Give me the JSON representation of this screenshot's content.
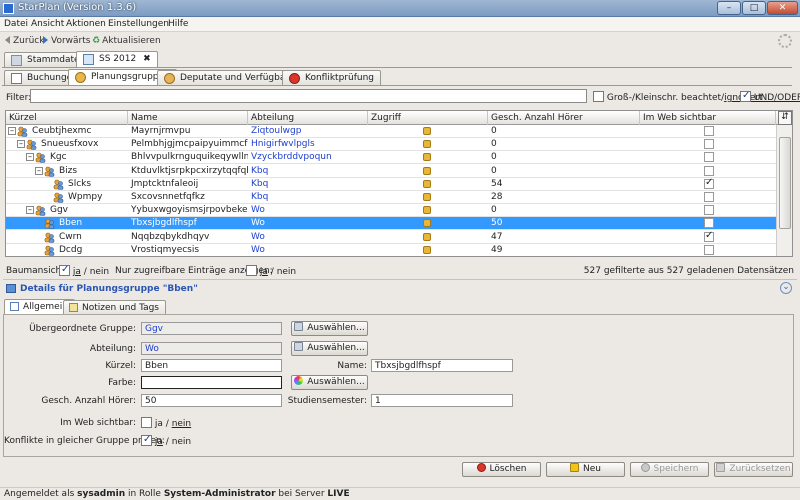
{
  "window": {
    "title": "StarPlan (Version 1.3.6)",
    "minimize": "–",
    "maximize": "□",
    "close": "✕"
  },
  "menu": [
    "Datei",
    "Ansicht",
    "Aktionen",
    "Einstellungen",
    "Hilfe"
  ],
  "nav": {
    "back": "Zurück",
    "forward": "Vorwärts",
    "refresh": "Aktualisieren"
  },
  "outer_tabs": [
    {
      "label": "Stammdaten"
    },
    {
      "label": "SS 2012",
      "close": "✖"
    }
  ],
  "inner_tabs": [
    {
      "label": "Buchungen"
    },
    {
      "label": "Planungsgruppen"
    },
    {
      "label": "Deputate und Verfügbarkeit"
    },
    {
      "label": "Konfliktprüfung"
    }
  ],
  "filter": {
    "label": "Filter:",
    "value": "",
    "case_label": "Groß-/Kleinschr. beachtet/",
    "ignore_label": "ignoriert",
    "andor_label": "UND/ODER",
    "case_checked": false,
    "andor_checked": true
  },
  "table": {
    "columns": [
      "Kürzel",
      "Name",
      "Abteilung",
      "Zugriff",
      "Gesch. Anzahl Hörer",
      "Im Web sichtbar"
    ],
    "rows": [
      {
        "kuerzel": "Ceubtjhexmc",
        "name": "Mayrnjrmvpu",
        "abteilung": "Ziqtoulwgp",
        "hoerer": "0",
        "web": false,
        "level": 0,
        "toggle": "–",
        "selected": false
      },
      {
        "kuerzel": "Snueusfxovx",
        "name": "Pelmbhjgjmcpaipyuimmcf",
        "abteilung": "Hnigirfwvlpgls",
        "hoerer": "0",
        "web": false,
        "level": 1,
        "toggle": "–",
        "selected": false
      },
      {
        "kuerzel": "Kgc",
        "name": "Bhlvvpulkrnguquikeqywllnyggt...",
        "abteilung": "Vzyckbrddvpoqun",
        "hoerer": "0",
        "web": false,
        "level": 2,
        "toggle": "–",
        "selected": false
      },
      {
        "kuerzel": "Bizs",
        "name": "Ktduvlktjsrpkpcxirzytqqfqhfnok...",
        "abteilung": "Kbq",
        "hoerer": "0",
        "web": false,
        "level": 3,
        "toggle": "–",
        "selected": false
      },
      {
        "kuerzel": "Slcks",
        "name": "Jmptcktnfaleoij",
        "abteilung": "Kbq",
        "hoerer": "54",
        "web": true,
        "level": 4,
        "toggle": "",
        "selected": false
      },
      {
        "kuerzel": "Wpmpy",
        "name": "Sxcovsnnetfqfkz",
        "abteilung": "Kbq",
        "hoerer": "28",
        "web": false,
        "level": 4,
        "toggle": "",
        "selected": false
      },
      {
        "kuerzel": "Ggv",
        "name": "Yybuxwgoyismsjrpovbekeduzk...",
        "abteilung": "Wo",
        "hoerer": "0",
        "web": false,
        "level": 2,
        "toggle": "–",
        "selected": false
      },
      {
        "kuerzel": "Bben",
        "name": "Tbxsjbgdlfhspf",
        "abteilung": "Wo",
        "hoerer": "50",
        "web": false,
        "level": 3,
        "toggle": "",
        "selected": true
      },
      {
        "kuerzel": "Cwrn",
        "name": "Nqqbzqbykdhqyv",
        "abteilung": "Wo",
        "hoerer": "47",
        "web": true,
        "level": 3,
        "toggle": "",
        "selected": false
      },
      {
        "kuerzel": "Dcdg",
        "name": "Vrostiqmyecsis",
        "abteilung": "Wo",
        "hoerer": "49",
        "web": false,
        "level": 3,
        "toggle": "",
        "selected": false
      }
    ]
  },
  "tree_view": {
    "label": "Baumansicht:",
    "yes": "ja",
    "sep": "/",
    "no": "nein",
    "checked": true
  },
  "only_accessible": {
    "label": "Nur zugreifbare Einträge anzeigen:",
    "yes": "ja",
    "sep": "/",
    "no": "nein",
    "checked": false
  },
  "record_count": "527 gefilterte aus 527 geladenen Datensätzen",
  "details": {
    "title": "Details für Planungsgruppe \"Bben\"",
    "collapse_icon": "⌄",
    "tabs": [
      "Allgemein",
      "Notizen und Tags"
    ],
    "parent_label": "Übergeordnete Gruppe:",
    "parent_value": "Ggv",
    "dept_label": "Abteilung:",
    "dept_value": "Wo",
    "kuerzel_label": "Kürzel:",
    "kuerzel_value": "Bben",
    "name_label": "Name:",
    "name_value": "Tbxsjbgdlfhspf",
    "color_label": "Farbe:",
    "color_value": "",
    "hoerer_label": "Gesch. Anzahl Hörer:",
    "hoerer_value": "50",
    "semester_label": "Studiensemester:",
    "semester_value": "1",
    "web_label": "Im Web sichtbar:",
    "web_yes": "ja",
    "web_sep": "/",
    "web_no": "nein",
    "web_checked": false,
    "conflict_label": "Konflikte in gleicher Gruppe prüfen:",
    "conflict_yes": "ja",
    "conflict_sep": "/",
    "conflict_no": "nein",
    "conflict_checked": true,
    "choose_label": "Auswählen..."
  },
  "actions": {
    "delete": "Löschen",
    "new": "Neu",
    "save": "Speichern",
    "reset": "Zurücksetzen"
  },
  "status": {
    "prefix": "Angemeldet als",
    "user": "sysadmin",
    "mid": "in Rolle",
    "role": "System-Administrator",
    "mid2": "bei Server",
    "server": "LIVE"
  }
}
